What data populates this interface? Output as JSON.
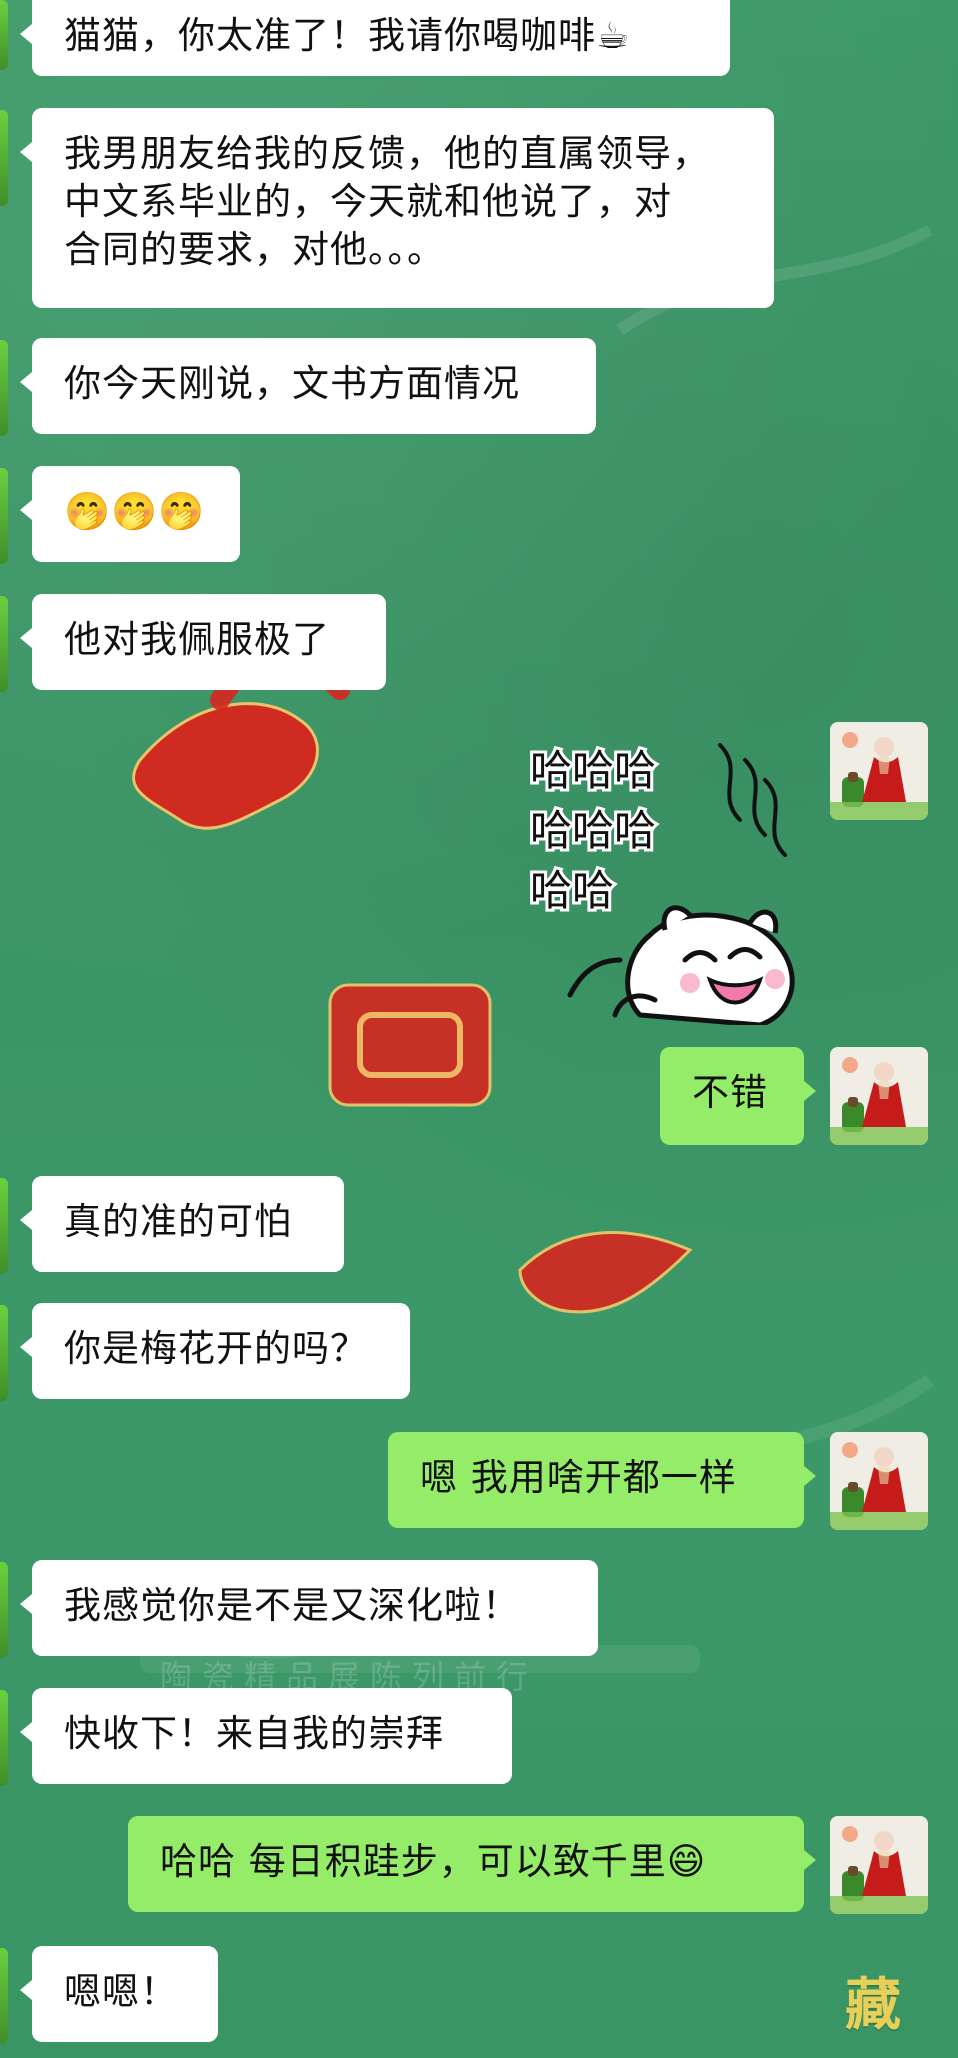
{
  "chat": {
    "messages": [
      {
        "side": "left",
        "text": "猫猫，你太准了！我请你喝咖啡☕"
      },
      {
        "side": "left",
        "lines": [
          "我男朋友给我的反馈，他的直属领导，",
          "中文系毕业的，今天就和他说了，对",
          "合同的要求，对他。。。"
        ]
      },
      {
        "side": "left",
        "text": "你今天刚说，文书方面情况"
      },
      {
        "side": "left",
        "text": "🤭🤭🤭"
      },
      {
        "side": "left",
        "text": "他对我佩服极了"
      },
      {
        "side": "right",
        "type": "sticker",
        "sticker_text": [
          "哈哈哈",
          "哈哈哈",
          "哈哈"
        ]
      },
      {
        "side": "right",
        "text": "不错"
      },
      {
        "side": "left",
        "text": "真的准的可怕"
      },
      {
        "side": "left",
        "text": "你是梅花开的吗？"
      },
      {
        "side": "right",
        "text": "嗯  我用啥开都一样"
      },
      {
        "side": "left",
        "text": "我感觉你是不是又深化啦！"
      },
      {
        "side": "left",
        "text": "快收下！来自我的崇拜"
      },
      {
        "side": "right",
        "text": "哈哈  每日积跬步，可以致千里😄"
      },
      {
        "side": "left",
        "text": "嗯嗯！"
      }
    ]
  },
  "background": {
    "watermark_text": "陶瓷精品展陈列前行",
    "corner_char": "藏"
  },
  "colors": {
    "background": "#3e9a69",
    "incoming_bubble": "#ffffff",
    "outgoing_bubble": "#95ec69",
    "accent_red": "#d7261e"
  },
  "icons": {
    "avatar": "avatar-woman-in-red",
    "sticker": "laughing-cat-sticker"
  }
}
